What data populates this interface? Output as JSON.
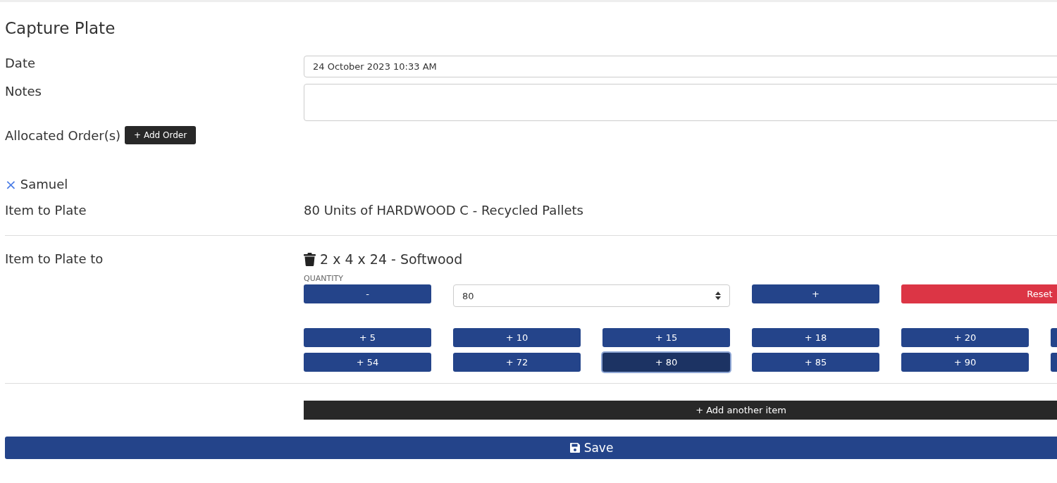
{
  "title": "Capture Plate",
  "fields": [
    {
      "label": "Date",
      "kind": "input",
      "value": "24 October 2023 10:33 AM"
    },
    {
      "label": "Notes",
      "kind": "textarea"
    }
  ],
  "allocated": {
    "label": "Allocated Order(s)",
    "button": "+ Add Order"
  },
  "orders": [
    {
      "name": "Samuel",
      "remove_icon": "×"
    }
  ],
  "item_to_plate": {
    "label": "Item to Plate",
    "value": "80 Units of HARDWOOD C - Recycled Pallets"
  },
  "plate_to": {
    "label": "Item to Plate to",
    "item": "2 x 4 x 24 - Softwood",
    "quantity_label": "QUANTITY",
    "minus": "-",
    "quantity": "80",
    "plus": "+",
    "reset": "Reset",
    "quick_rows": [
      {
        "buttons": [
          {
            "label": "+ 5",
            "selected": false
          },
          {
            "label": "+ 10",
            "selected": false
          },
          {
            "label": "+ 15",
            "selected": false
          },
          {
            "label": "+ 18",
            "selected": false
          },
          {
            "label": "+ 20",
            "selected": false
          }
        ],
        "clipped_more": true
      },
      {
        "buttons": [
          {
            "label": "+ 54",
            "selected": false
          },
          {
            "label": "+ 72",
            "selected": false
          },
          {
            "label": "+ 80",
            "selected": true
          },
          {
            "label": "+ 85",
            "selected": false
          },
          {
            "label": "+ 90",
            "selected": false
          }
        ],
        "clipped_more": true
      }
    ]
  },
  "add_item": "+ Add another item",
  "save": "Save"
}
